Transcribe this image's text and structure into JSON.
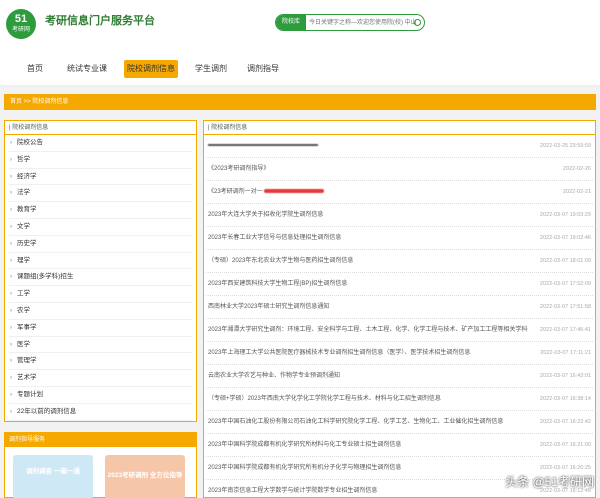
{
  "header": {
    "logo_number": "51",
    "logo_text": "考研网",
    "site_title": "考研信息门户服务平台",
    "search_scope": "院校库",
    "search_placeholder": "今日关键字之称—欢迎您使用院(校) 中山大学"
  },
  "nav": {
    "items": [
      {
        "label": "首页"
      },
      {
        "label": "统试专业课"
      },
      {
        "label": "院校调剂信息"
      },
      {
        "label": "学生调剂"
      },
      {
        "label": "调剂指导"
      }
    ],
    "active_index": 2
  },
  "breadcrumb": "首页 >> 院校调剂信息",
  "left_panel": {
    "title": "| 院校调剂信息",
    "items": [
      "院校公告",
      "哲学",
      "经济学",
      "法学",
      "教育学",
      "文学",
      "历史学",
      "理学",
      "课题组(多学科)招生",
      "工学",
      "农学",
      "军事学",
      "医学",
      "管理学",
      "艺术学",
      "专题计划",
      "22年以前的调剂信息"
    ]
  },
  "promo": {
    "title": "调剂指导服务",
    "card_a": "调剂调查 一键一通",
    "card_b": "2023考研调剂 全方位指导"
  },
  "right_panel": {
    "title": "| 院校调剂信息",
    "items": [
      {
        "title": "",
        "date": "2022-03-25 23:59:59"
      },
      {
        "title": "《2023考研调剂指导》",
        "date": "2022-02-26"
      },
      {
        "title": "《23考研调剂一对一",
        "date": "2022-02-21"
      },
      {
        "title": "2023年大连大学关于招收化学院生调剂信息",
        "date": "2022-03-07 19:03:29"
      },
      {
        "title": "2023年长春工业大学信号与信息处理招生调剂信息",
        "date": "2022-03-07 19:02:46"
      },
      {
        "title": "（专硕）2023年东北农业大学生物与医药招生调剂信息",
        "date": "2022-03-07 18:01:09"
      },
      {
        "title": "2023年西安建筑科技大学生物工程(BP)招生调剂信息",
        "date": "2022-03-07 17:52:09"
      },
      {
        "title": "西南林业大学2023年硕士研究生调剂信息通知",
        "date": "2022-03-07 17:51:58"
      },
      {
        "title": "2023年湘潭大学研究生调剂：环境工程、安全科学与工程、土木工程、化学、化学工程与技术、矿产加工工程等相关学科调剂信息",
        "date": "2022-03-07 17:46:41"
      },
      {
        "title": "2023年上海理工大学公共医院医疗器械技术专业调剂招生调剂信息（医学）、医学技术招生调剂信息",
        "date": "2022-03-07 17:11:21"
      },
      {
        "title": "云南农业大学农艺与种业、作物学专业预调剂通知",
        "date": "2022-03-07 16:43:01"
      },
      {
        "title": "（专硕+学硕）2023年西南大学化学化工学院化学工程与技术、材料与化工招生调剂信息",
        "date": "2022-03-07 16:38:14"
      },
      {
        "title": "2023年中国石油化工股份有限公司石油化工科学研究院化学工程、化学工艺、生物化工、工业催化招生调剂信息",
        "date": "2022-03-07 16:23:42"
      },
      {
        "title": "2023年中国科学院成都有机化学研究所材料与化工专业硕士招生调剂信息",
        "date": "2022-03-07 16:21:00"
      },
      {
        "title": "2023年中国科学院成都有机化学研究所有机分子化学与物理招生调剂信息",
        "date": "2022-03-07 16:20:25"
      },
      {
        "title": "2023年南京信息工程大学数学与统计学院数学专业招生调剂信息",
        "date": "2022-03-07 16:12:49"
      }
    ]
  },
  "watermark": "头条 @51考研网"
}
